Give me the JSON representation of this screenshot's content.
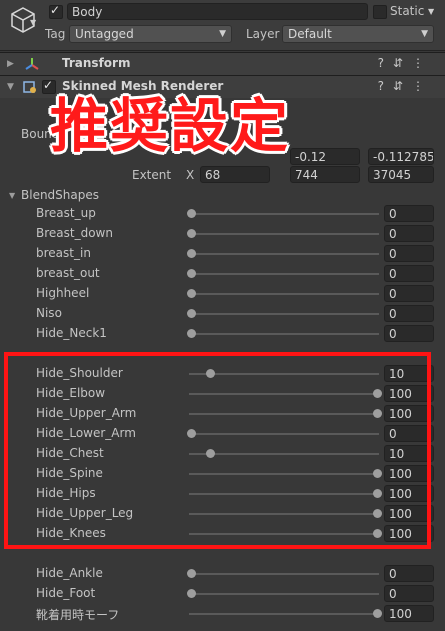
{
  "header": {
    "object_name": "Body",
    "static_label": "Static",
    "tag_label": "Tag",
    "tag_value": "Untagged",
    "layer_label": "Layer",
    "layer_value": "Default"
  },
  "components": {
    "transform_title": "Transform",
    "renderer_title": "Skinned Mesh Renderer"
  },
  "bounds": {
    "label": "Bounds",
    "extent_label": "Extent",
    "x_label": "X",
    "center_z": "-0.1127854",
    "center_y_partial": "-0.12",
    "extent_x_partial": "68",
    "extent_y_partial": "744",
    "extent_z_partial": "37045"
  },
  "blendshapes": {
    "title": "BlendShapes",
    "rows": [
      {
        "name": "Breast_up",
        "value": "0",
        "fraction": 0
      },
      {
        "name": "Breast_down",
        "value": "0",
        "fraction": 0
      },
      {
        "name": "breast_in",
        "value": "0",
        "fraction": 0
      },
      {
        "name": "breast_out",
        "value": "0",
        "fraction": 0
      },
      {
        "name": "Highheel",
        "value": "0",
        "fraction": 0
      },
      {
        "name": "Niso",
        "value": "0",
        "fraction": 0
      },
      {
        "name": "Hide_Neck1",
        "value": "0",
        "fraction": 0
      },
      {
        "name": "Hide_Shoulder",
        "value": "10",
        "fraction": 0.1
      },
      {
        "name": "Hide_Elbow",
        "value": "100",
        "fraction": 1
      },
      {
        "name": "Hide_Upper_Arm",
        "value": "100",
        "fraction": 1
      },
      {
        "name": "Hide_Lower_Arm",
        "value": "0",
        "fraction": 0
      },
      {
        "name": "Hide_Chest",
        "value": "10",
        "fraction": 0.1
      },
      {
        "name": "Hide_Spine",
        "value": "100",
        "fraction": 1
      },
      {
        "name": "Hide_Hips",
        "value": "100",
        "fraction": 1
      },
      {
        "name": "Hide_Upper_Leg",
        "value": "100",
        "fraction": 1
      },
      {
        "name": "Hide_Knees",
        "value": "100",
        "fraction": 1
      },
      {
        "name": "Hide_Ankle",
        "value": "0",
        "fraction": 0
      },
      {
        "name": "Hide_Foot",
        "value": "0",
        "fraction": 0
      },
      {
        "name": "靴着用時モーフ",
        "value": "100",
        "fraction": 1
      }
    ]
  },
  "overlay": {
    "title": "推奨設定",
    "color": "#ff1a1a"
  }
}
